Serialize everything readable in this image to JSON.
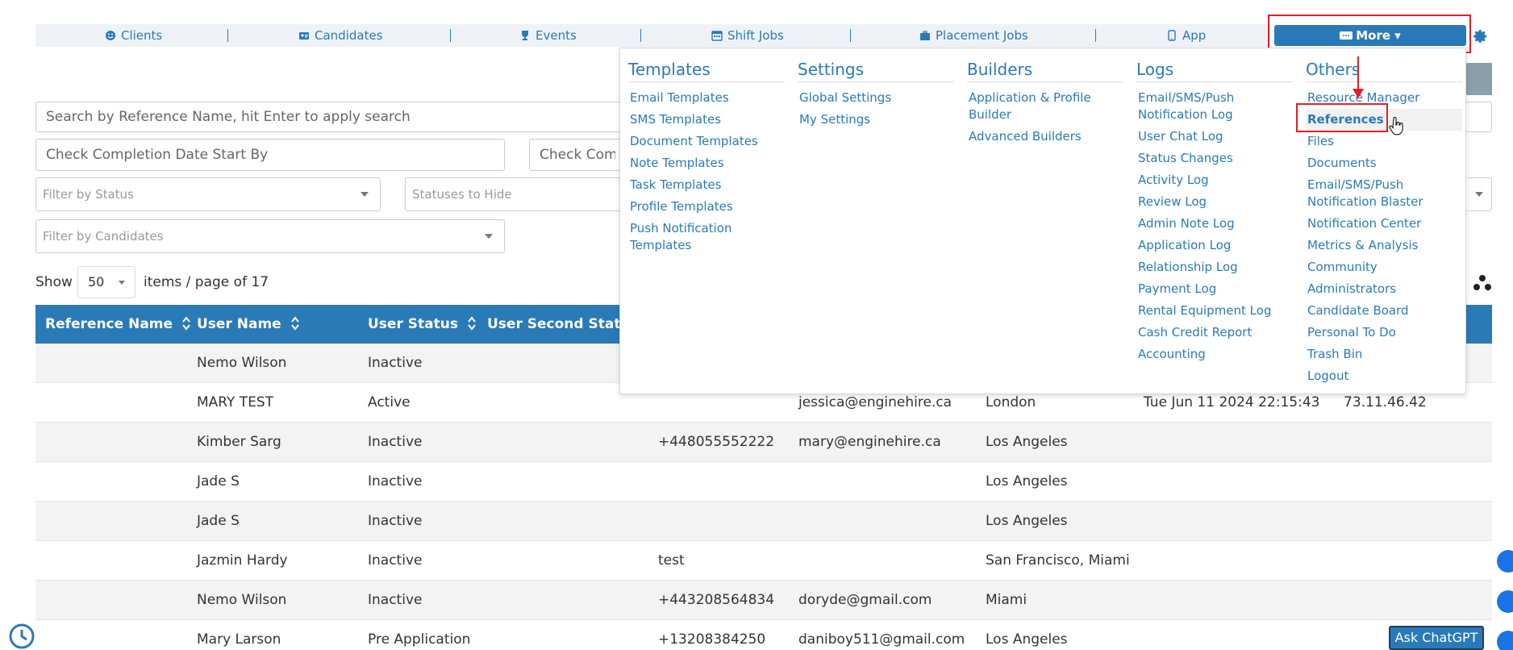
{
  "nav": {
    "items": [
      {
        "label": "Clients",
        "icon": "smile-icon"
      },
      {
        "label": "Candidates",
        "icon": "id-card-icon"
      },
      {
        "label": "Events",
        "icon": "trophy-icon"
      },
      {
        "label": "Shift Jobs",
        "icon": "calendar-icon"
      },
      {
        "label": "Placement Jobs",
        "icon": "briefcase-icon"
      },
      {
        "label": "App",
        "icon": "mobile-icon"
      }
    ],
    "more_label": "More ▾"
  },
  "filters": {
    "search_placeholder": "Search by Reference Name, hit Enter to apply search",
    "completion_start_placeholder": "Check Completion Date Start By",
    "completion_end_placeholder": "Check Comp",
    "status_placeholder": "Filter by Status",
    "hide_placeholder": "Statuses to Hide",
    "candidates_placeholder": "Filter by Candidates"
  },
  "pagination": {
    "show_label": "Show",
    "page_size": "50",
    "per_page_text": "items / page of 17"
  },
  "table": {
    "headers": [
      "Reference Name",
      "User Name",
      "User Status",
      "User Second Status"
    ],
    "rows": [
      {
        "user": "Nemo Wilson",
        "status": "Inactive",
        "phone": "",
        "email": "",
        "city": "",
        "date": "",
        "ip": ""
      },
      {
        "user": "MARY TEST",
        "status": "Active",
        "phone": "",
        "email": "jessica@enginehire.ca",
        "city": "London",
        "date": "Tue Jun 11 2024 22:15:43",
        "ip": "73.11.46.42"
      },
      {
        "user": "Kimber Sarg",
        "status": "Inactive",
        "phone": "+448055552222",
        "email": "mary@enginehire.ca",
        "city": "Los Angeles",
        "date": "",
        "ip": ""
      },
      {
        "user": "Jade S",
        "status": "Inactive",
        "phone": "",
        "email": "",
        "city": "Los Angeles",
        "date": "",
        "ip": ""
      },
      {
        "user": "Jade S",
        "status": "Inactive",
        "phone": "",
        "email": "",
        "city": "Los Angeles",
        "date": "",
        "ip": ""
      },
      {
        "user": "Jazmin Hardy",
        "status": "Inactive",
        "phone": "test",
        "email": "",
        "city": "San Francisco, Miami",
        "date": "",
        "ip": ""
      },
      {
        "user": "Nemo Wilson",
        "status": "Inactive",
        "phone": "+443208564834",
        "email": "doryde@gmail.com",
        "city": "Miami",
        "date": "",
        "ip": ""
      },
      {
        "user": "Mary Larson",
        "status": "Pre Application",
        "phone": "+13208384250",
        "email": "daniboy511@gmail.com",
        "city": "Los Angeles",
        "date": "",
        "ip": ""
      }
    ]
  },
  "menu": {
    "columns": [
      {
        "title": "Templates",
        "links": [
          "Email Templates",
          "SMS Templates",
          "Document Templates",
          "Note Templates",
          "Task Templates",
          "Profile Templates",
          "Push Notification Templates"
        ]
      },
      {
        "title": "Settings",
        "links": [
          "Global Settings",
          "My Settings"
        ]
      },
      {
        "title": "Builders",
        "links": [
          "Application & Profile Builder",
          "Advanced Builders"
        ]
      },
      {
        "title": "Logs",
        "links": [
          "Email/SMS/Push Notification Log",
          "User Chat Log",
          "Status Changes",
          "Activity Log",
          "Review Log",
          "Admin Note Log",
          "Application Log",
          "Relationship Log",
          "Payment Log",
          "Rental Equipment Log",
          "Cash Credit Report",
          "Accounting"
        ]
      },
      {
        "title": "Others",
        "links": [
          "Resource Manager",
          "References",
          "Files",
          "Documents",
          "Email/SMS/Push Notification Blaster",
          "Notification Center",
          "Metrics & Analysis",
          "Community",
          "Administrators",
          "Candidate Board",
          "Personal To Do",
          "Trash Bin",
          "Logout"
        ]
      }
    ],
    "active_link": "References"
  },
  "widgets": {
    "ask_label": "Ask ChatGPT"
  },
  "colors": {
    "primary": "#2a7ab8",
    "highlight": "#e41e26"
  }
}
